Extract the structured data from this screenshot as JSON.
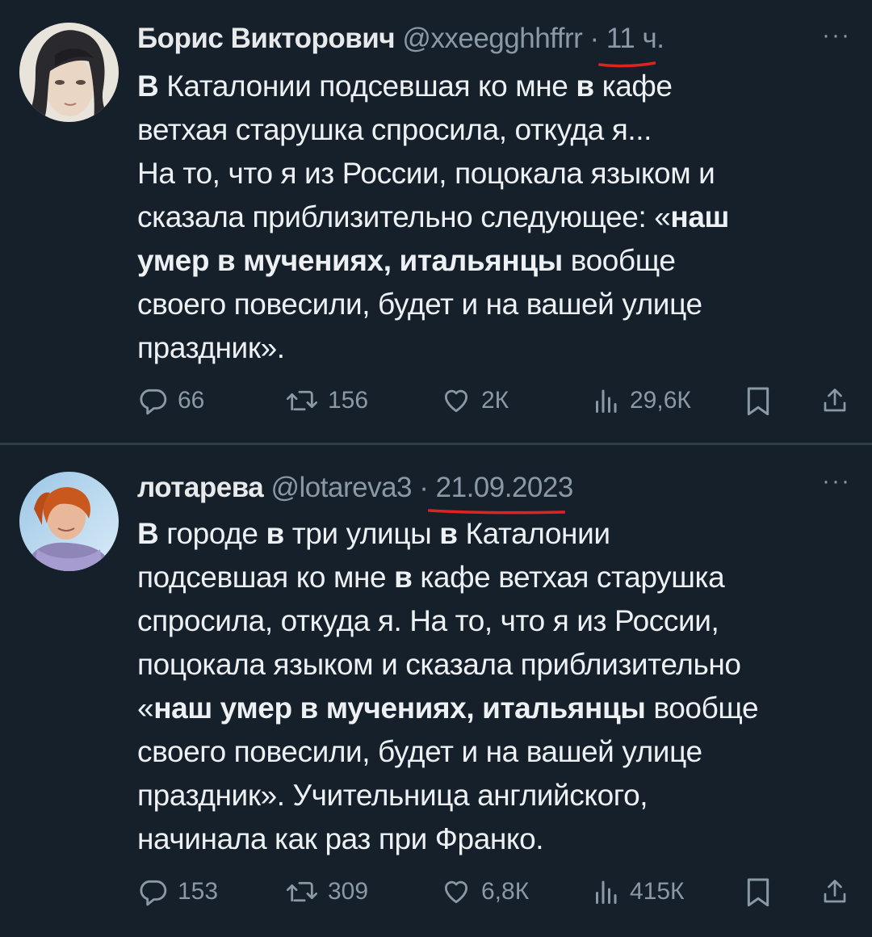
{
  "tweets": [
    {
      "author_name": "Борис Викторович",
      "handle": "@xxeegghhffrr",
      "separator": "·",
      "time": "11 ч.",
      "more": "···",
      "body_lines": [
        [
          {
            "t": "В",
            "b": true
          },
          {
            "t": " Каталонии подсевшая ко мне ",
            "b": false
          },
          {
            "t": "в",
            "b": true
          },
          {
            "t": " кафе",
            "b": false
          }
        ],
        [
          {
            "t": "ветхая старушка спросила, откуда я...",
            "b": false
          }
        ],
        [
          {
            "t": "На то, что я из России, поцокала языком и",
            "b": false
          }
        ],
        [
          {
            "t": "сказала приблизительно следующее: «",
            "b": false
          },
          {
            "t": "наш",
            "b": true
          }
        ],
        [
          {
            "t": "умер в мучениях, итальянцы",
            "b": true
          },
          {
            "t": " вообще",
            "b": false
          }
        ],
        [
          {
            "t": "своего повесили, будет и на вашей улице",
            "b": false
          }
        ],
        [
          {
            "t": "праздник».",
            "b": false
          }
        ]
      ],
      "stats": {
        "replies": "66",
        "retweets": "156",
        "likes": "2К",
        "views": "29,6К"
      }
    },
    {
      "author_name": "лотарева",
      "handle": "@lotareva3",
      "separator": "·",
      "time": "21.09.2023",
      "more": "···",
      "body_lines": [
        [
          {
            "t": "В",
            "b": true
          },
          {
            "t": " городе ",
            "b": false
          },
          {
            "t": "в",
            "b": true
          },
          {
            "t": " три улицы ",
            "b": false
          },
          {
            "t": "в",
            "b": true
          },
          {
            "t": " Каталонии",
            "b": false
          }
        ],
        [
          {
            "t": "подсевшая ко мне ",
            "b": false
          },
          {
            "t": "в",
            "b": true
          },
          {
            "t": " кафе ветхая старушка",
            "b": false
          }
        ],
        [
          {
            "t": "спросила, откуда я. На то, что я из России,",
            "b": false
          }
        ],
        [
          {
            "t": "поцокала языком и сказала приблизительно",
            "b": false
          }
        ],
        [
          {
            "t": "«",
            "b": false
          },
          {
            "t": "наш умер в мучениях, итальянцы",
            "b": true
          },
          {
            "t": " вообще",
            "b": false
          }
        ],
        [
          {
            "t": "своего повесили, будет и на вашей улице",
            "b": false
          }
        ],
        [
          {
            "t": "праздник». Учительница английского,",
            "b": false
          }
        ],
        [
          {
            "t": "начинала как раз при Франко.",
            "b": false
          }
        ]
      ],
      "stats": {
        "replies": "153",
        "retweets": "309",
        "likes": "6,8К",
        "views": "415К"
      }
    }
  ],
  "colors": {
    "background": "#15202b",
    "text": "#e7e9ea",
    "secondary": "#8b98a5",
    "annotation_underline": "#e0231e"
  },
  "icons": [
    "reply-icon",
    "retweet-icon",
    "like-icon",
    "views-icon",
    "bookmark-icon",
    "share-icon",
    "more-icon"
  ]
}
